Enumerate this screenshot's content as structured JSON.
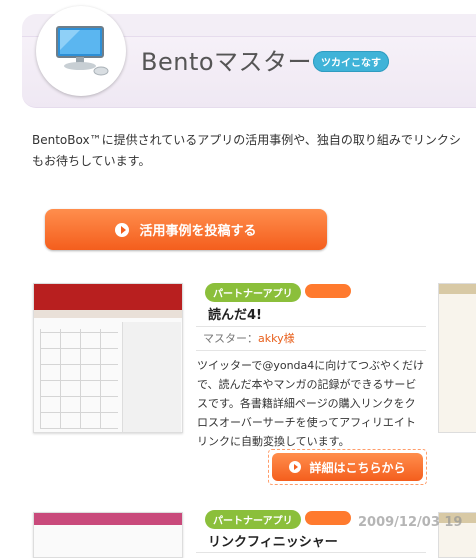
{
  "header": {
    "title": "Bentoマスター",
    "badge": "ツカイこなす"
  },
  "intro": {
    "line1": "BentoBox™に提供されているアプリの活用事例や、独自の取り組みでリンクシ",
    "line2": "もお待ちしています。"
  },
  "cta": {
    "label": "活用事例を投稿する"
  },
  "apps": [
    {
      "tag": "パートナーアプリ",
      "name": "読んだ4!",
      "master_label": "マスター：",
      "master_name": "akky様",
      "description": "ツイッターで@yonda4に向けてつぶやくだけで、読んだ本やマンガの記録ができるサービスです。各書籍詳細ページの購入リンクをクロスオーバーサーチを使ってアフィリエイトリンクに自動変換しています。",
      "detail_label": "詳細はこちらから"
    },
    {
      "tag": "パートナーアプリ",
      "name": "リンクフィニッシャー"
    }
  ],
  "watermark": "2009/12/03 19",
  "colors": {
    "accent_orange": "#f45e1d",
    "tag_green": "#8bbf3b",
    "badge_blue": "#3fb3d8"
  }
}
